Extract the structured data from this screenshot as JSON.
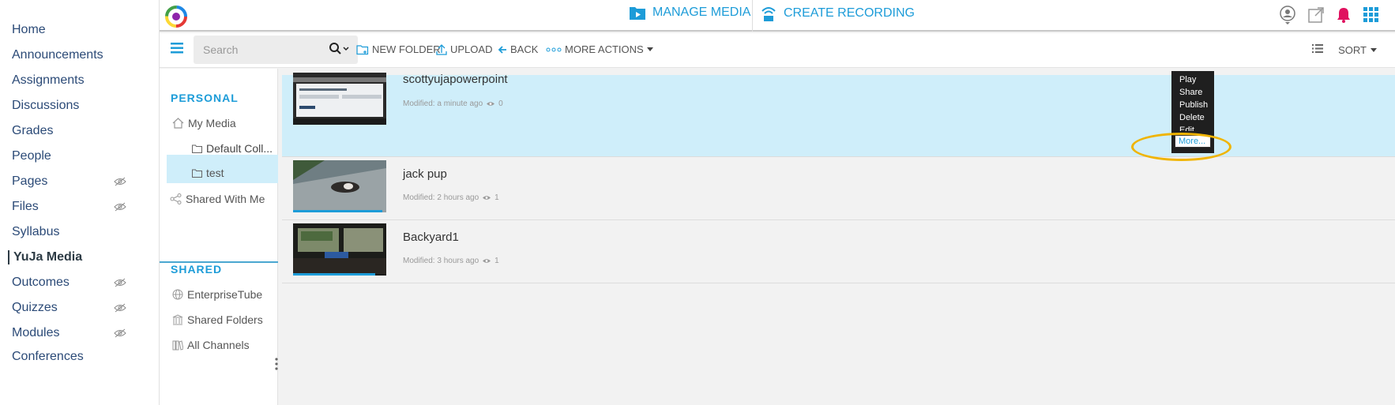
{
  "course_nav": [
    "Home",
    "Announcements",
    "Assignments",
    "Discussions",
    "Grades",
    "People",
    "Pages",
    "Files",
    "Syllabus",
    "YuJa Media",
    "Outcomes",
    "Quizzes",
    "Modules",
    "Conferences"
  ],
  "topbar": {
    "manage_media": "MANAGE MEDIA",
    "create_recording": "CREATE RECORDING"
  },
  "toolbar": {
    "search_placeholder": "Search",
    "new_folder": "NEW FOLDER",
    "upload": "UPLOAD",
    "back": "BACK",
    "more_actions": "MORE ACTIONS",
    "sort": "SORT"
  },
  "tree": {
    "personal_heading": "PERSONAL",
    "my_media": "My Media",
    "default_coll": "Default Coll...",
    "test": "test",
    "shared_with_me": "Shared With Me",
    "shared_heading": "SHARED",
    "enterprisetube": "EnterpriseTube",
    "shared_folders": "Shared Folders",
    "all_channels": "All Channels"
  },
  "media": [
    {
      "title": "scottyujapowerpoint",
      "modified": "Modified: a minute ago",
      "views": "0"
    },
    {
      "title": "jack pup",
      "modified": "Modified: 2 hours ago",
      "views": "1"
    },
    {
      "title": "Backyard1",
      "modified": "Modified: 3 hours ago",
      "views": "1"
    }
  ],
  "context_menu": {
    "play": "Play",
    "share": "Share",
    "publish": "Publish",
    "delete": "Delete",
    "edit": "Edit",
    "more": "More..."
  },
  "colors": {
    "accent": "#1d9cd8",
    "selected_row": "#cfeefa",
    "highlight_oval": "#f0b400",
    "bell": "#e0115f"
  }
}
